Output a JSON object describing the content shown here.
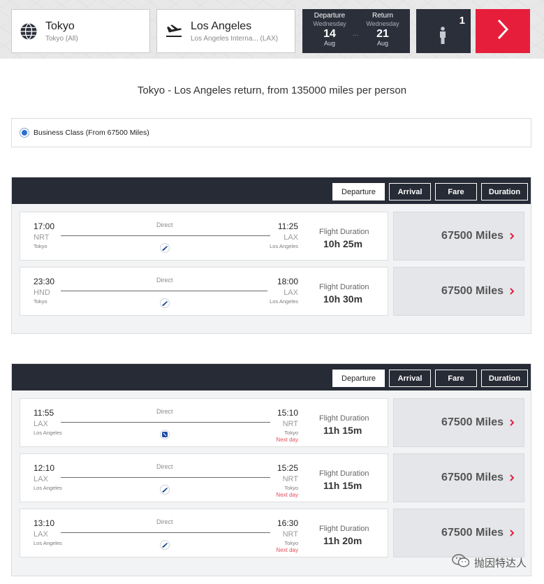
{
  "search": {
    "origin": {
      "city": "Tokyo",
      "airport": "Tokyo (All)",
      "icon": "globe-icon"
    },
    "destination": {
      "city": "Los Angeles",
      "airport": "Los Angeles Interna... (LAX)",
      "icon": "plane-landing-icon"
    },
    "departure": {
      "label": "Departure",
      "weekday": "Wednesday",
      "day": "14",
      "month": "Aug"
    },
    "return": {
      "label": "Return",
      "weekday": "Wednesday",
      "day": "21",
      "month": "Aug"
    },
    "date_separator": "...",
    "passengers": "1",
    "passenger_icon": "person-icon",
    "go_icon": "chevron-right-icon"
  },
  "summary": "Tokyo - Los Angeles return, from 135000 miles per person",
  "cabin": {
    "label": "Business Class (From 67500 Miles)",
    "selected": true
  },
  "sort_options": [
    "Departure",
    "Arrival",
    "Fare",
    "Duration"
  ],
  "active_sort": "Departure",
  "duration_label": "Flight Duration",
  "stop_label": "Direct",
  "outbound": [
    {
      "dep_time": "17:00",
      "dep_code": "NRT",
      "dep_city": "Tokyo",
      "arr_time": "11:25",
      "arr_code": "LAX",
      "arr_city": "Los Angeles",
      "next_day": "",
      "duration": "10h 25m",
      "price": "67500 Miles",
      "airline_icon": "ana-logo-icon"
    },
    {
      "dep_time": "23:30",
      "dep_code": "HND",
      "dep_city": "Tokyo",
      "arr_time": "18:00",
      "arr_code": "LAX",
      "arr_city": "Los Angeles",
      "next_day": "",
      "duration": "10h 30m",
      "price": "67500 Miles",
      "airline_icon": "ana-logo-icon"
    }
  ],
  "return_flights": [
    {
      "dep_time": "11:55",
      "dep_code": "LAX",
      "dep_city": "Los Angeles",
      "arr_time": "15:10",
      "arr_code": "NRT",
      "arr_city": "Tokyo",
      "next_day": "Next day",
      "duration": "11h 15m",
      "price": "67500 Miles",
      "airline_icon": "united-logo-icon"
    },
    {
      "dep_time": "12:10",
      "dep_code": "LAX",
      "dep_city": "Los Angeles",
      "arr_time": "15:25",
      "arr_code": "NRT",
      "arr_city": "Tokyo",
      "next_day": "Next day",
      "duration": "11h 15m",
      "price": "67500 Miles",
      "airline_icon": "ana-logo-icon"
    },
    {
      "dep_time": "13:10",
      "dep_code": "LAX",
      "dep_city": "Los Angeles",
      "arr_time": "16:30",
      "arr_code": "NRT",
      "arr_city": "Tokyo",
      "next_day": "Next day",
      "duration": "11h 20m",
      "price": "67500 Miles",
      "airline_icon": "ana-logo-icon"
    }
  ],
  "watermark": "抛因特达人",
  "colors": {
    "accent_red": "#e61e3c",
    "header_dark": "#272b36",
    "radio_blue": "#2c6fd1",
    "next_day_red": "#e0505a"
  }
}
